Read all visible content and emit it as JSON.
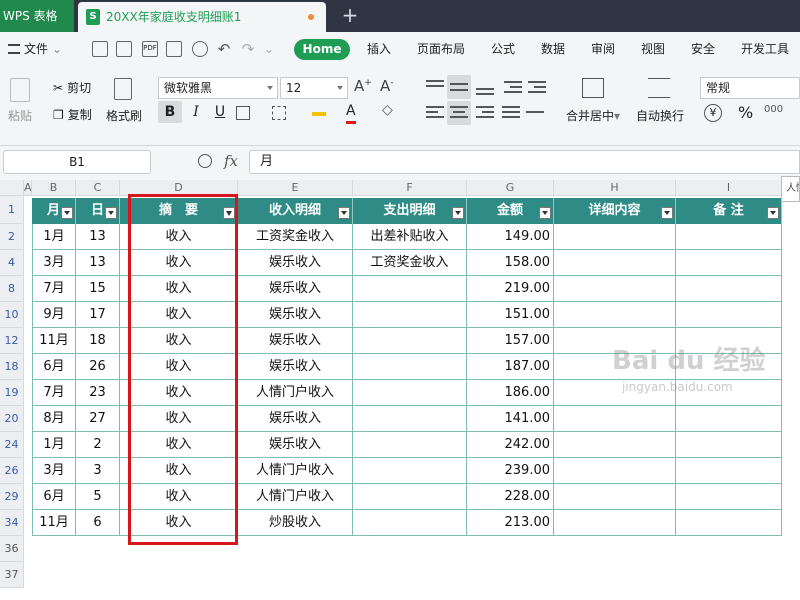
{
  "title_bar": {
    "app_name": "WPS 表格",
    "doc_title": "20XX年家庭收支明细账1",
    "new_tab": "+"
  },
  "menu": {
    "file": "文件",
    "items": [
      "Home",
      "插入",
      "页面布局",
      "公式",
      "数据",
      "审阅",
      "视图",
      "安全",
      "开发工具"
    ]
  },
  "ribbon": {
    "paste": "粘贴",
    "cut": "剪切",
    "copy": "复制",
    "format_painter": "格式刷",
    "font_name": "微软雅黑",
    "font_size": "12",
    "bold": "B",
    "italic": "I",
    "underline": "U",
    "merge_center": "合并居中",
    "wrap_text": "自动换行",
    "number_format": "常规",
    "currency": "¥",
    "percent": "%"
  },
  "formula_bar": {
    "cell_ref": "B1",
    "fx": "fx",
    "content": "月"
  },
  "columns": [
    "A",
    "B",
    "C",
    "D",
    "E",
    "F",
    "G",
    "H",
    "I"
  ],
  "headers": [
    "月",
    "日",
    "摘　要",
    "收入明细",
    "支出明细",
    "金额",
    "详细内容",
    "备 注"
  ],
  "rows": [
    {
      "num": "2",
      "month": "1月",
      "day": "13",
      "summary": "收入",
      "income": "工资奖金收入",
      "expense": "出差补贴收入",
      "amount": "149.00"
    },
    {
      "num": "4",
      "month": "3月",
      "day": "13",
      "summary": "收入",
      "income": "娱乐收入",
      "expense": "工资奖金收入",
      "amount": "158.00"
    },
    {
      "num": "8",
      "month": "7月",
      "day": "15",
      "summary": "收入",
      "income": "娱乐收入",
      "expense": "",
      "amount": "219.00"
    },
    {
      "num": "10",
      "month": "9月",
      "day": "17",
      "summary": "收入",
      "income": "娱乐收入",
      "expense": "",
      "amount": "151.00"
    },
    {
      "num": "12",
      "month": "11月",
      "day": "18",
      "summary": "收入",
      "income": "娱乐收入",
      "expense": "",
      "amount": "157.00"
    },
    {
      "num": "18",
      "month": "6月",
      "day": "26",
      "summary": "收入",
      "income": "娱乐收入",
      "expense": "",
      "amount": "187.00"
    },
    {
      "num": "19",
      "month": "7月",
      "day": "23",
      "summary": "收入",
      "income": "人情门户收入",
      "expense": "",
      "amount": "186.00"
    },
    {
      "num": "20",
      "month": "8月",
      "day": "27",
      "summary": "收入",
      "income": "娱乐收入",
      "expense": "",
      "amount": "141.00"
    },
    {
      "num": "24",
      "month": "1月",
      "day": "2",
      "summary": "收入",
      "income": "娱乐收入",
      "expense": "",
      "amount": "242.00"
    },
    {
      "num": "26",
      "month": "3月",
      "day": "3",
      "summary": "收入",
      "income": "人情门户收入",
      "expense": "",
      "amount": "239.00"
    },
    {
      "num": "29",
      "month": "6月",
      "day": "5",
      "summary": "收入",
      "income": "人情门户收入",
      "expense": "",
      "amount": "228.00"
    },
    {
      "num": "34",
      "month": "11月",
      "day": "6",
      "summary": "收入",
      "income": "炒股收入",
      "expense": "",
      "amount": "213.00"
    }
  ],
  "header_row_num": "1",
  "trailing_rows": [
    "36",
    "37"
  ],
  "tooltip_peek": "人情",
  "watermark": {
    "main": "Bai du 经验",
    "sub": "jingyan.baidu.com"
  },
  "colors": {
    "accent": "#1f9d55",
    "header_fill": "#2e8b86",
    "highlight": "#d7151c"
  }
}
